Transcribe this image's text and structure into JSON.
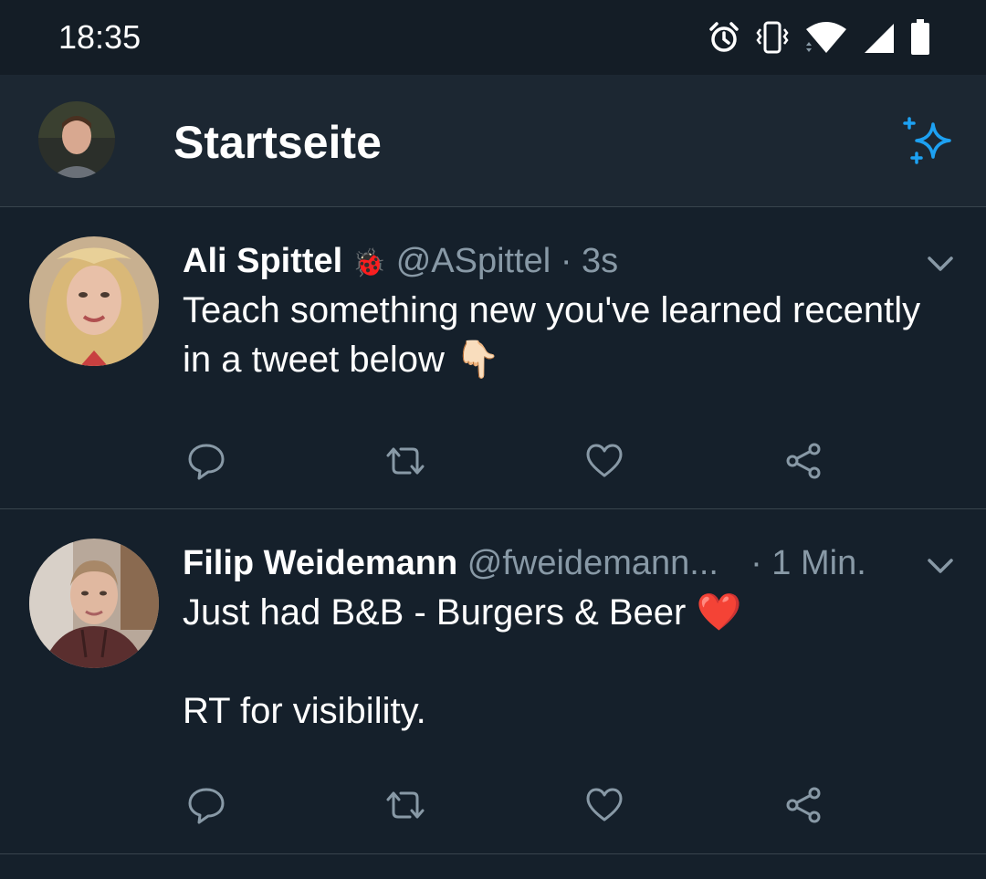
{
  "status_bar": {
    "time": "18:35",
    "icons": [
      "alarm-icon",
      "vibrate-icon",
      "wifi-icon",
      "cell-signal-icon",
      "battery-icon"
    ]
  },
  "header": {
    "title": "Startseite",
    "avatar_icon": "profile-avatar",
    "action_icon": "sparkle-icon",
    "accent_color": "#1da1f2"
  },
  "tweets": [
    {
      "name": "Ali Spittel",
      "badge_emoji": "🐞",
      "handle": "@ASpittel",
      "separator": "·",
      "time": "3s",
      "text_lines": [
        "Teach something new you've learned recently in a tweet below 👇🏻"
      ],
      "actions": [
        "reply-icon",
        "retweet-icon",
        "like-icon",
        "share-icon"
      ]
    },
    {
      "name": "Filip Weidemann",
      "handle": "@fweidemann...",
      "separator": "·",
      "time": "1 Min.",
      "text_lines": [
        "Just had B&B - Burgers & Beer ❤️",
        "",
        "RT for visibility."
      ],
      "actions": [
        "reply-icon",
        "retweet-icon",
        "like-icon",
        "share-icon"
      ]
    }
  ],
  "colors": {
    "background": "#15202b",
    "header_background": "#1c2732",
    "secondary_text": "#8899a6",
    "divider": "#38444d",
    "icon": "#8899a6"
  }
}
